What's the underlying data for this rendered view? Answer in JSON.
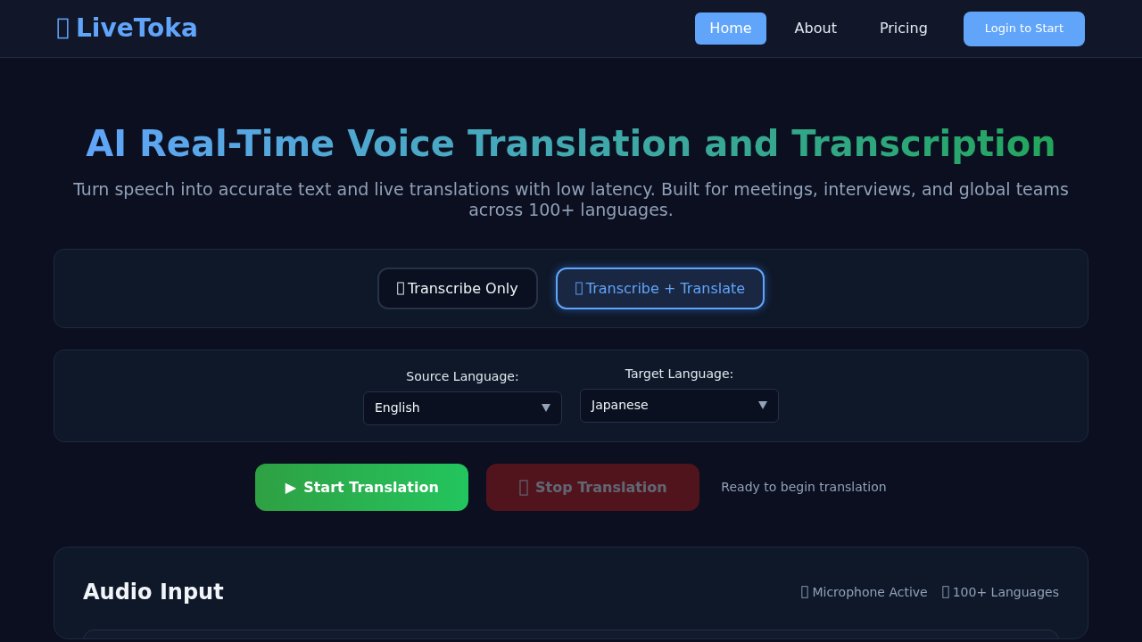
{
  "nav": {
    "brand": "LiveToka",
    "links": [
      {
        "label": "Home",
        "selected": true
      },
      {
        "label": "About",
        "selected": false
      },
      {
        "label": "Pricing",
        "selected": false
      }
    ],
    "login": "Login to Start"
  },
  "hero": {
    "title": "AI Real-Time Voice Translation and Transcription",
    "subtitle": "Turn speech into accurate text and live translations with low latency. Built for meetings, interviews, and global teams across 100+ languages."
  },
  "modes": [
    {
      "label": "Transcribe Only",
      "selected": false
    },
    {
      "label": "Transcribe + Translate",
      "selected": true
    }
  ],
  "languages": [
    {
      "label": "Source Language:",
      "value": "English"
    },
    {
      "label": "Target Language:",
      "value": "Japanese"
    }
  ],
  "actions": [
    {
      "kind": "start",
      "icon": "▶",
      "label": "Start Translation",
      "disabled": false
    },
    {
      "kind": "stop",
      "label": "Stop Translation",
      "disabled": true
    }
  ],
  "status": "Ready to begin translation",
  "audio_panel": {
    "title": "Audio Input",
    "badges": [
      "Microphone Active",
      "100+ Languages"
    ]
  }
}
